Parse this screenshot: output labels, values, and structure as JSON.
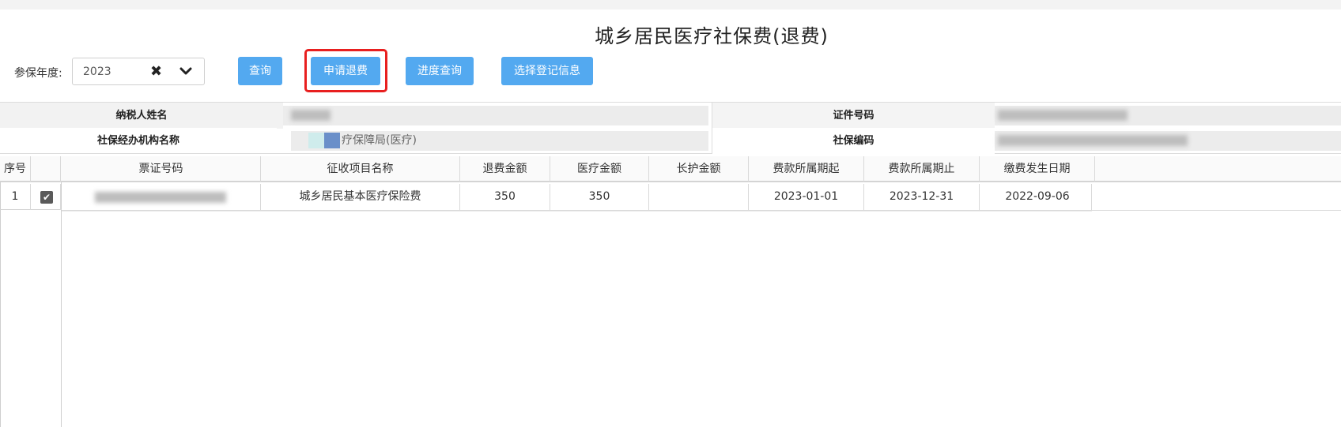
{
  "page": {
    "title": "城乡居民医疗社保费(退费)"
  },
  "filter": {
    "year_label": "参保年度:",
    "year_value": "2023",
    "clear_glyph": "✖"
  },
  "toolbar": {
    "query_label": "查询",
    "refund_label": "申请退费",
    "progress_label": "进度查询",
    "select_label": "选择登记信息"
  },
  "info": {
    "taxpayer_name_label": "纳税人姓名",
    "id_number_label": "证件号码",
    "agency_label": "社保经办机构名称",
    "agency_value": "疗保障局(医疗)",
    "ss_code_label": "社保编码"
  },
  "table": {
    "headers": [
      "序号",
      "",
      "票证号码",
      "征收项目名称",
      "退费金额",
      "医疗金额",
      "长护金额",
      "费款所属期起",
      "费款所属期止",
      "缴费发生日期"
    ],
    "rows": [
      {
        "index": "1",
        "checked": true,
        "ticket_no": "",
        "item_name": "城乡居民基本医疗保险费",
        "refund_amount": "350",
        "medical_amount": "350",
        "ltc_amount": "",
        "period_start": "2023-01-01",
        "period_end": "2023-12-31",
        "pay_date": "2022-09-06"
      }
    ]
  },
  "colors": {
    "button": "#53a9f0",
    "highlight": "#e81f1f"
  }
}
